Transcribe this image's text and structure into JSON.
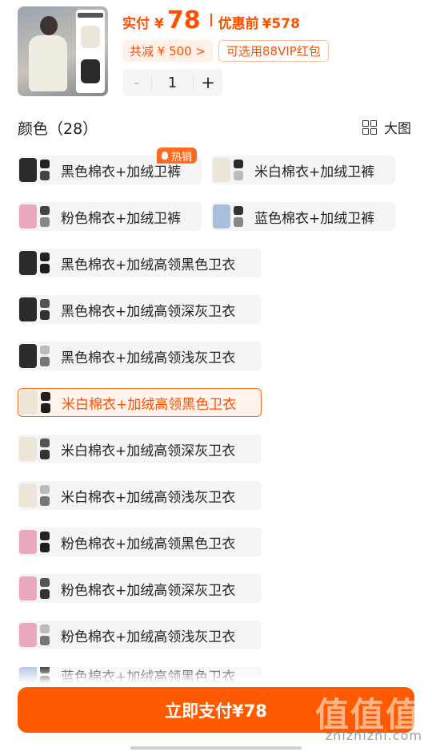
{
  "price": {
    "label": "实付",
    "currency": "¥",
    "value": "78",
    "original_label": "优惠前",
    "original_value": "¥578"
  },
  "promos": {
    "save": "共减 ¥ 500 >",
    "vip": "可选用88VIP红包"
  },
  "stepper": {
    "minus": "-",
    "quantity": "1",
    "plus": "+"
  },
  "thumb_text": "",
  "section": {
    "title": "颜色（28）",
    "big_view": "大图"
  },
  "hot_badge": "热销",
  "options": [
    {
      "label": "黑色棉衣+加绒卫裤",
      "selected": false
    },
    {
      "label": "米白棉衣+加绒卫裤",
      "selected": false
    },
    {
      "label": "粉色棉衣+加绒卫裤",
      "selected": false
    },
    {
      "label": "蓝色棉衣+加绒卫裤",
      "selected": false
    },
    {
      "label": "黑色棉衣+加绒高领黑色卫衣",
      "selected": false
    },
    {
      "label": "黑色棉衣+加绒高领深灰卫衣",
      "selected": false
    },
    {
      "label": "黑色棉衣+加绒高领浅灰卫衣",
      "selected": false
    },
    {
      "label": "米白棉衣+加绒高领黑色卫衣",
      "selected": true
    },
    {
      "label": "米白棉衣+加绒高领深灰卫衣",
      "selected": false
    },
    {
      "label": "米白棉衣+加绒高领浅灰卫衣",
      "selected": false
    },
    {
      "label": "粉色棉衣+加绒高领黑色卫衣",
      "selected": false
    },
    {
      "label": "粉色棉衣+加绒高领深灰卫衣",
      "selected": false
    },
    {
      "label": "粉色棉衣+加绒高领浅灰卫衣",
      "selected": false
    },
    {
      "label": "蓝色棉衣+加绒高领黑色卫衣",
      "selected": false
    }
  ],
  "pay_button": "立即支付¥78",
  "watermark": {
    "text": "值值值",
    "sub": "zhizhizhi.com"
  },
  "colors": {
    "accent": "#ff5000",
    "button": "#ff5a00",
    "option_bg": "#f5f5f5"
  }
}
